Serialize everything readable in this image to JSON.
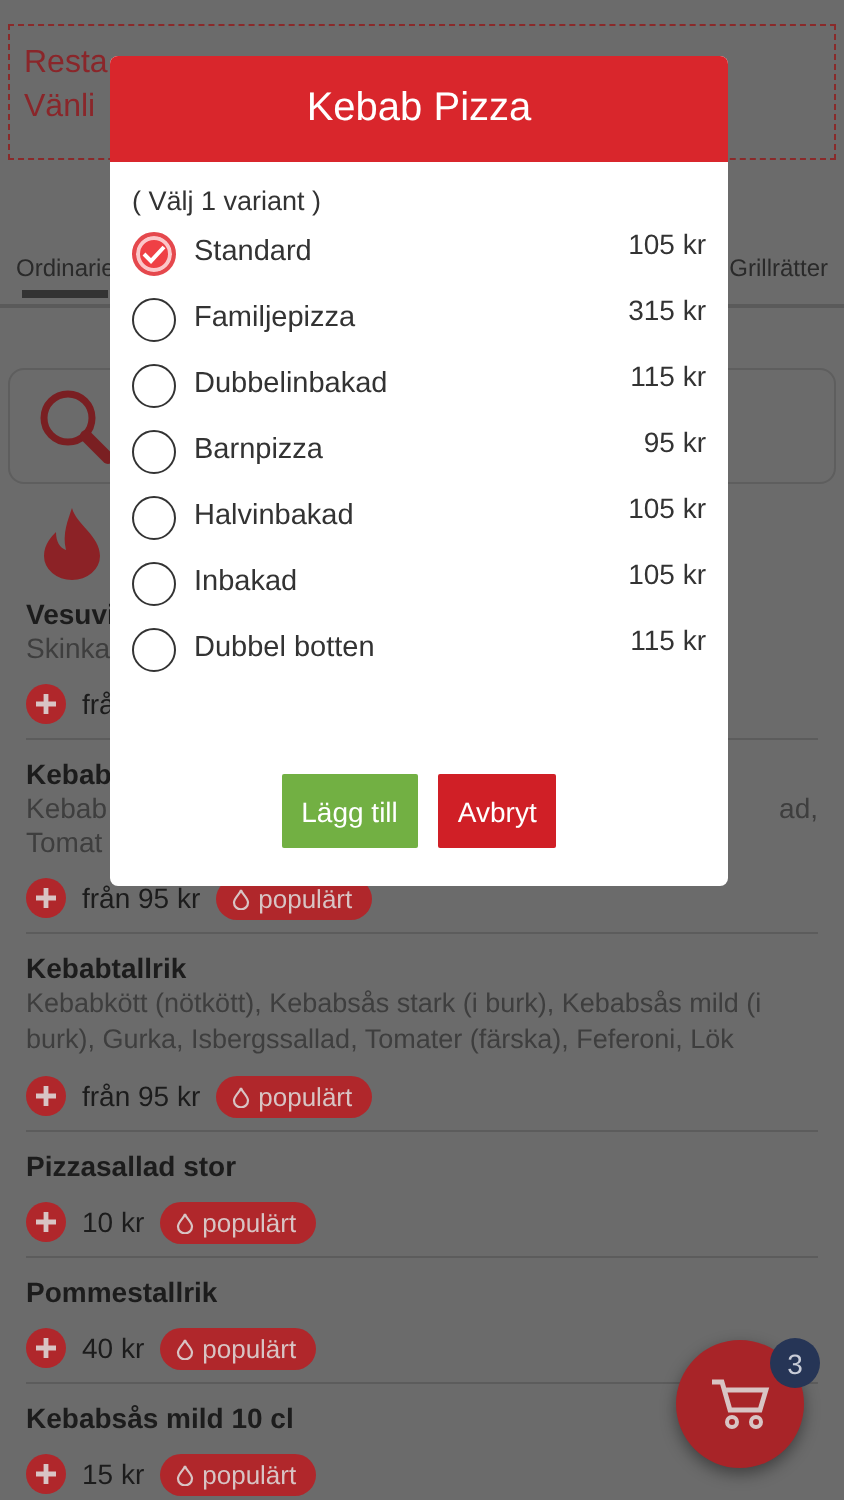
{
  "notice": {
    "lines": [
      "Resta",
      "Vänli"
    ]
  },
  "tabs": [
    {
      "label": "Ordinarie",
      "selected": true
    },
    {
      "label": "Grillrätter",
      "selected": false
    }
  ],
  "menu_items": [
    {
      "name": "Vesuvi",
      "description_lines": [
        {
          "left": "Skinka"
        }
      ],
      "price": "frå"
    },
    {
      "name": "Kebab",
      "description_lines": [
        {
          "left": "Kebab",
          "right": "ad,"
        },
        {
          "left": "Tomat"
        }
      ],
      "price": "från 95 kr",
      "badge": "populärt"
    },
    {
      "name": "Kebabtallrik",
      "description": "Kebabkött (nötkött), Kebabsås stark (i burk), Kebabsås mild (i burk), Gurka, Isbergssallad, Tomater (färska), Feferoni, Lök",
      "price": "från 95 kr",
      "badge": "populärt"
    },
    {
      "name": "Pizzasallad stor",
      "price": "10 kr",
      "badge": "populärt"
    },
    {
      "name": "Pommestallrik",
      "price": "40 kr",
      "badge": "populärt"
    },
    {
      "name": "Kebabsås mild 10 cl",
      "price": "15 kr",
      "badge": "populärt"
    }
  ],
  "cart": {
    "count": "3"
  },
  "dialog": {
    "title": "Kebab Pizza",
    "hint": "( Välj 1 variant )",
    "options": [
      {
        "label": "Standard",
        "price": "105 kr",
        "selected": true
      },
      {
        "label": "Familjepizza",
        "price": "315 kr",
        "selected": false
      },
      {
        "label": "Dubbelinbakad",
        "price": "115 kr",
        "selected": false
      },
      {
        "label": "Barnpizza",
        "price": "95 kr",
        "selected": false
      },
      {
        "label": "Halvinbakad",
        "price": "105 kr",
        "selected": false
      },
      {
        "label": "Inbakad",
        "price": "105 kr",
        "selected": false
      },
      {
        "label": "Dubbel botten",
        "price": "115 kr",
        "selected": false
      }
    ],
    "buttons": [
      {
        "label": "Lägg till",
        "kind": "primary"
      },
      {
        "label": "Avbryt",
        "kind": "cancel"
      }
    ]
  }
}
